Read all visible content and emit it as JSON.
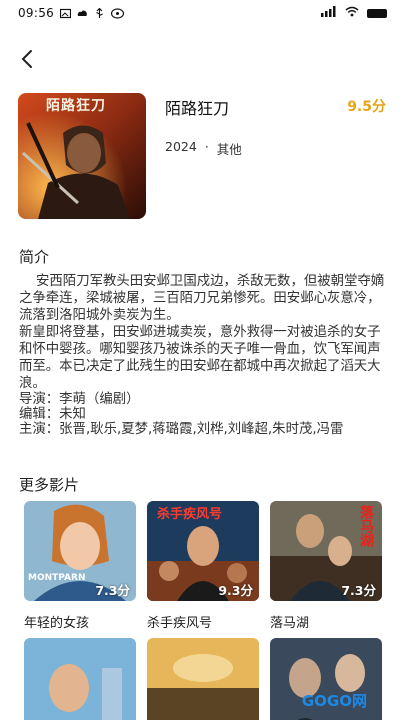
{
  "status_bar": {
    "time": "09:56",
    "icons": [
      "image-icon",
      "cloud-icon",
      "usb-icon",
      "sim-icon"
    ],
    "right_icons": [
      "signal-icon",
      "wifi-icon",
      "battery-icon"
    ]
  },
  "header": {
    "back_icon": "chevron-left-icon"
  },
  "movie": {
    "title": "陌路狂刀",
    "score": "9.5分",
    "year": "2024",
    "separator": "·",
    "genre": "其他",
    "poster_title_text": "陌路狂刀"
  },
  "synopsis": {
    "heading": "简介",
    "text": "    安西陌刀军教头田安邺卫国戍边，杀敌无数，但被朝堂夺嫡之争牵连，梁城被屠，三百陌刀兄弟惨死。田安邺心灰意冷，流落到洛阳城外卖炭为生。\n新皇即将登基，田安邺进城卖炭，意外救得一对被追杀的女子和怀中婴孩。哪知婴孩乃被诛杀的天子唯一骨血，饮飞军闻声而至。本已决定了此残生的田安邺在都城中再次掀起了滔天大浪。"
  },
  "credits": {
    "director": "导演：李萌（编剧）",
    "writer": "编辑：未知",
    "cast": "主演：张晋,耿乐,夏梦,蒋璐霞,刘桦,刘峰超,朱时茂,冯雷"
  },
  "more": {
    "heading": "更多影片",
    "items": [
      {
        "title": "年轻的女孩",
        "score": "7.3分",
        "poster_text": "MONTPARN"
      },
      {
        "title": "杀手疾风号",
        "score": "9.3分",
        "poster_text": "杀手疾风号"
      },
      {
        "title": "落马湖",
        "score": "7.3分",
        "poster_text": "落马湖"
      },
      {
        "title": "",
        "score": "",
        "poster_text": ""
      },
      {
        "title": "",
        "score": "",
        "poster_text": ""
      },
      {
        "title": "",
        "score": "",
        "poster_text": ""
      }
    ]
  },
  "watermark": "GOGO网"
}
